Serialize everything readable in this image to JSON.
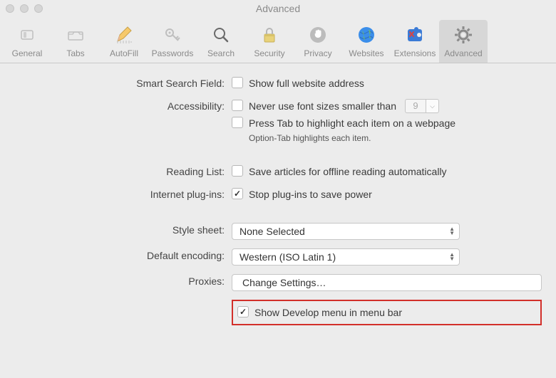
{
  "window": {
    "title": "Advanced"
  },
  "toolbar": {
    "items": [
      {
        "label": "General"
      },
      {
        "label": "Tabs"
      },
      {
        "label": "AutoFill"
      },
      {
        "label": "Passwords"
      },
      {
        "label": "Search"
      },
      {
        "label": "Security"
      },
      {
        "label": "Privacy"
      },
      {
        "label": "Websites"
      },
      {
        "label": "Extensions"
      },
      {
        "label": "Advanced"
      }
    ]
  },
  "section": {
    "smart_search": {
      "label": "Smart Search Field:",
      "show_full_address": "Show full website address"
    },
    "accessibility": {
      "label": "Accessibility:",
      "font_sizes": "Never use font sizes smaller than",
      "font_min_value": "9",
      "press_tab": "Press Tab to highlight each item on a webpage",
      "option_tab_hint": "Option-Tab highlights each item."
    },
    "reading_list": {
      "label": "Reading List:",
      "save_offline": "Save articles for offline reading automatically"
    },
    "internet_plugins": {
      "label": "Internet plug-ins:",
      "stop_plugins": "Stop plug-ins to save power"
    },
    "style_sheet": {
      "label": "Style sheet:",
      "value": "None Selected"
    },
    "default_encoding": {
      "label": "Default encoding:",
      "value": "Western (ISO Latin 1)"
    },
    "proxies": {
      "label": "Proxies:",
      "button": "Change Settings…"
    },
    "develop": {
      "label": "Show Develop menu in menu bar"
    }
  }
}
